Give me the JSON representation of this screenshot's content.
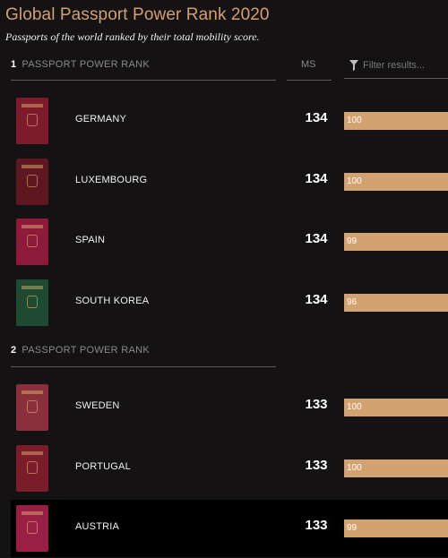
{
  "header": {
    "title": "Global Passport Power Rank 2020",
    "subtitle": "Passports of the world ranked by their total mobility score."
  },
  "columns": {
    "ms_label": "MS",
    "filter_placeholder": "Filter results..."
  },
  "groups": [
    {
      "rank": "1",
      "label": "PASSPORT POWER RANK",
      "rows": [
        {
          "country": "GERMANY",
          "ms": "134",
          "bar_value": "100",
          "bar_fraction": 1.0,
          "passport_color": "#7d1a2c"
        },
        {
          "country": "LUXEMBOURG",
          "ms": "134",
          "bar_value": "100",
          "bar_fraction": 1.0,
          "passport_color": "#5e1620"
        },
        {
          "country": "SPAIN",
          "ms": "134",
          "bar_value": "99",
          "bar_fraction": 1.0,
          "passport_color": "#8e1a3a"
        },
        {
          "country": "SOUTH KOREA",
          "ms": "134",
          "bar_value": "96",
          "bar_fraction": 1.0,
          "passport_color": "#1f4a32"
        }
      ]
    },
    {
      "rank": "2",
      "label": "PASSPORT POWER RANK",
      "rows": [
        {
          "country": "SWEDEN",
          "ms": "133",
          "bar_value": "100",
          "bar_fraction": 1.0,
          "passport_color": "#8a2f3c"
        },
        {
          "country": "PORTUGAL",
          "ms": "133",
          "bar_value": "100",
          "bar_fraction": 1.0,
          "passport_color": "#7a1c2a"
        },
        {
          "country": "AUSTRIA",
          "ms": "133",
          "bar_value": "99",
          "bar_fraction": 1.0,
          "passport_color": "#9a1f45"
        }
      ]
    }
  ],
  "colors": {
    "accent": "#d4a06c",
    "bar": "#d3a271",
    "background": "#141212",
    "active_row": "#000000"
  }
}
